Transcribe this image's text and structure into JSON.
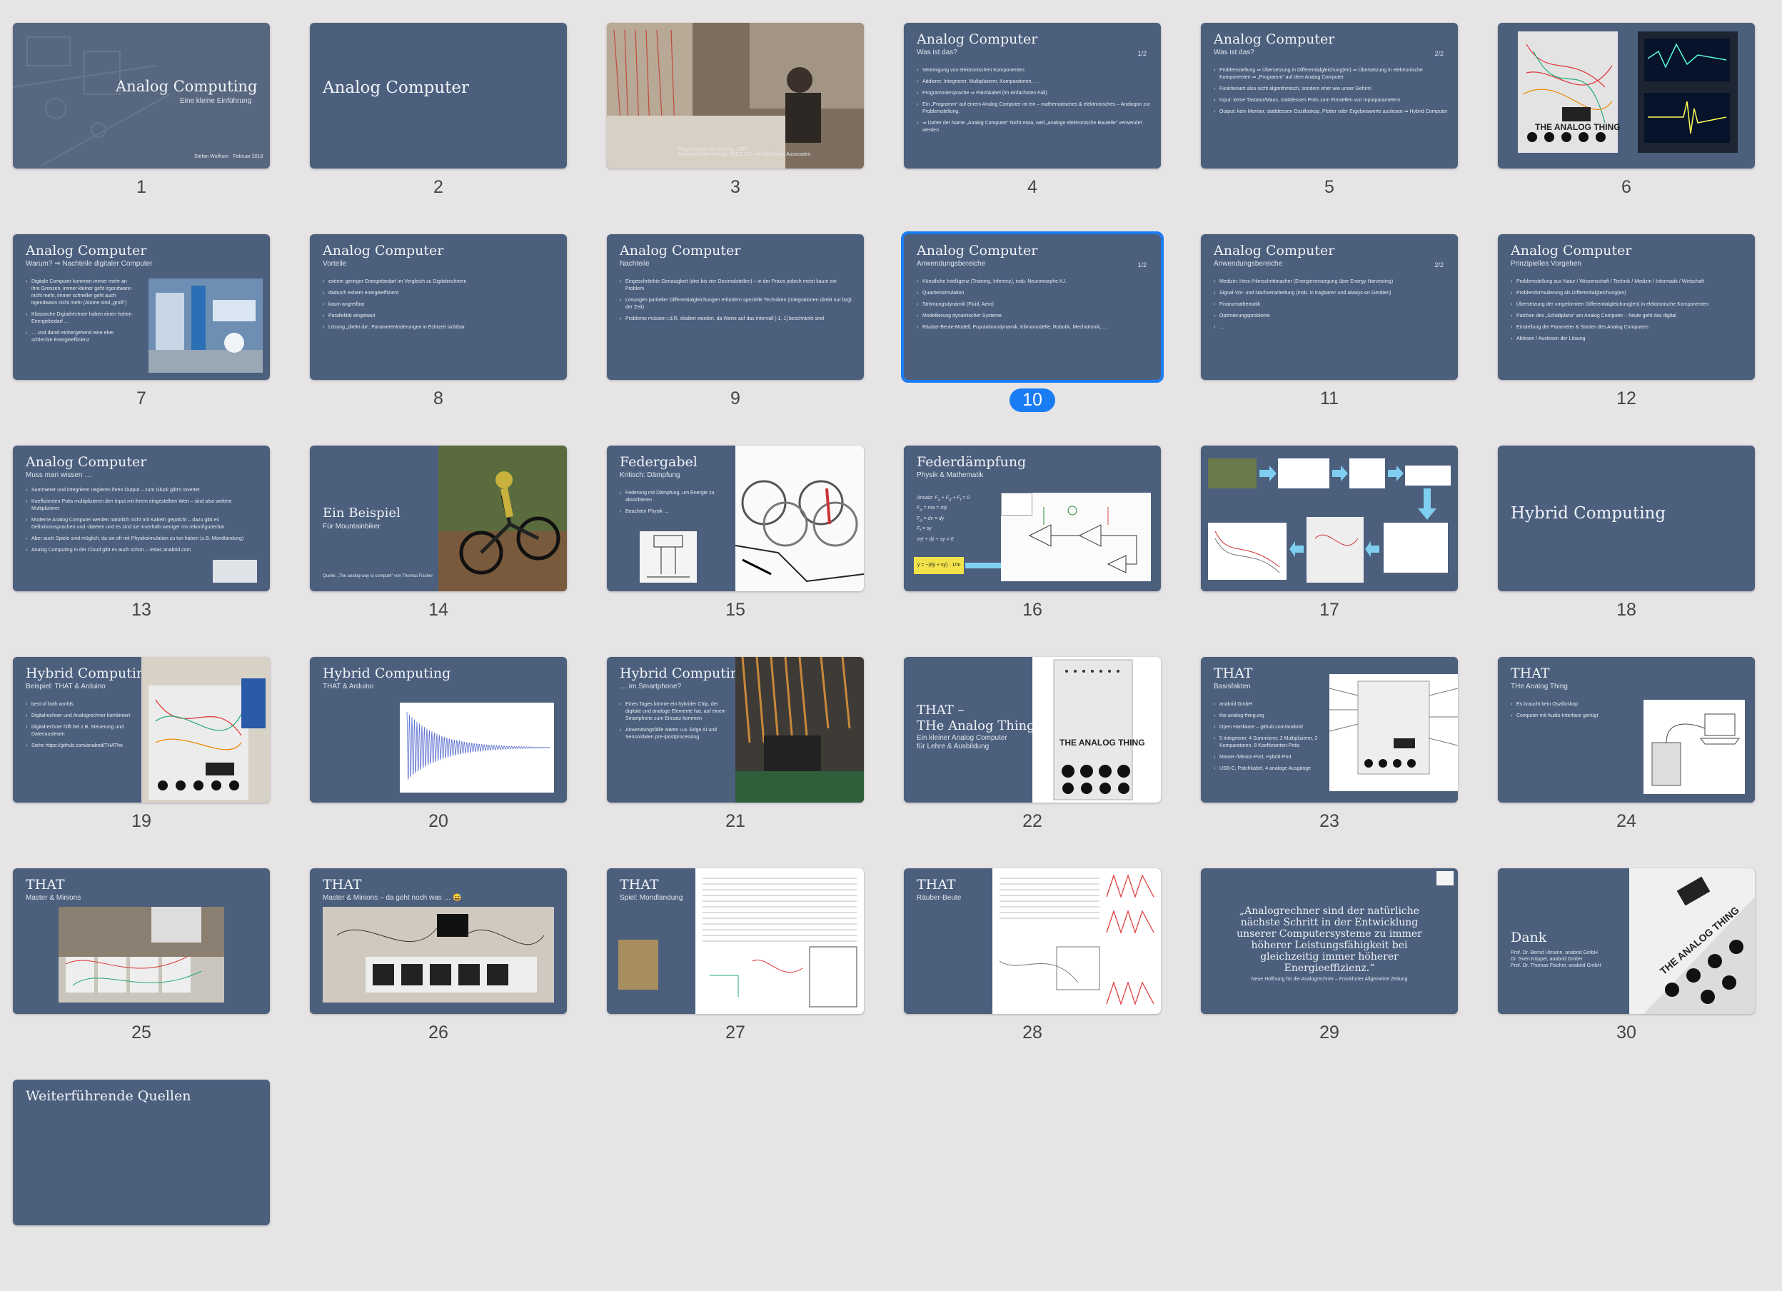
{
  "slides": [
    {
      "n": "1",
      "title": "Analog Computing",
      "subtitle": "Eine kleine Einführung",
      "footer": "Stefan Wolfrum · Februar 2018"
    },
    {
      "n": "2",
      "title": "Analog Computer"
    },
    {
      "n": "3",
      "caption": "Flugsimulator bei Boeing, 1960\nAnalogrechner-Anlage PACE 231 von Electronic Associates"
    },
    {
      "n": "4",
      "title": "Analog Computer",
      "subtitle": "Was ist das?",
      "page": "1/2",
      "bullets": [
        "Vereinigung von elektronischen Komponenten",
        "Addierer, Integrierer, Multiplizierer, Komparatoren, …",
        "Programmiersprache ⇒ Patchkabel (im einfachsten Fall)",
        "Ein „Programm“ auf einem Analog Computer ist ein – mathematisches & elektronisches – Analogon zur Problemstellung.",
        "⇒ Daher der Name „Analog Computer“ Nicht etwa, weil „analoge elektronische Bauteile“ verwendet werden"
      ]
    },
    {
      "n": "5",
      "title": "Analog Computer",
      "subtitle": "Was ist das?",
      "page": "2/2",
      "bullets": [
        "Problemstellung ⇒ Übersetzung in Differentialgleichung(en) ⇒ Übersetzung in elektronische Komponenten ⇒ „Programm“ auf dem Analog Computer",
        "Funktioniert also nicht algorithmisch, sondern eher wie unser Gehirn!",
        "Input: keine Tastatur/Maus, stattdessen Potis zum Einstellen von Inputparametern",
        "Output: kein Monitor, stattdessen Oszilloskop, Plotter oder Ergebniswerte auslesen ⇒ Hybrid Computer"
      ]
    },
    {
      "n": "6",
      "caption": "THE ANALOG THING"
    },
    {
      "n": "7",
      "title": "Analog Computer",
      "subtitle": "Warum? ⇒ Nachteile digitaler Computer",
      "bullets": [
        "Digitale Computer kommen immer mehr an ihre Grenzen, immer kleiner geht irgendwann nicht mehr, immer schneller geht auch irgendwann nicht mehr (Atome sind „groß“)",
        "Klassische Digitalrechner haben einen hohen Energiebedarf …",
        "… und damit einhergehend eine eher schlechte Energieeffizienz"
      ]
    },
    {
      "n": "8",
      "title": "Analog Computer",
      "subtitle": "Vorteile",
      "bullets": [
        "extrem geringer Energiebedarf im Vergleich zu Digitalrechnern",
        "dadurch extrem energieeffizient",
        "kaum angreifbar",
        "Parallelität eingebaut",
        "Lösung „direkt da“, Parameteränderungen in Echtzeit sichtbar"
      ]
    },
    {
      "n": "9",
      "title": "Analog Computer",
      "subtitle": "Nachteile",
      "bullets": [
        "Eingeschränkte Genauigkeit (drei bis vier Dezimalstellen) – in der Praxis jedoch meist kaum ein Problem",
        "Lösungen partieller Differentialgleichungen erfordern spezielle Techniken (Integrationen direkt nur bzgl. der Zeit)",
        "Probleme müssen i.d.R. skaliert werden, da Werte auf das Intervall [-1, 1] beschränkt sind"
      ]
    },
    {
      "n": "10",
      "title": "Analog Computer",
      "subtitle": "Anwendungsbereiche",
      "page": "1/2",
      "bullets": [
        "Künstliche Intelligenz (Training, Inferenz), insb. Neuromorphe K.I.",
        "Quantensimulation",
        "Strömungsdynamik (Fluid, Aero)",
        "Modellierung dynamischer Systeme",
        "Räuber-Beute-Modell, Populationsdynamik, Klimamodelle, Robotik, Mechatronik, …"
      ]
    },
    {
      "n": "11",
      "title": "Analog Computer",
      "subtitle": "Anwendungsbereiche",
      "page": "2/2",
      "bullets": [
        "Medizin: Herz-/Hirnschrittmacher (Energieversorgung über Energy Harvesting)",
        "Signal-Vor- und Nachverarbeitung (insb. in tragbaren und always-on Geräten)",
        "Finanzmathematik",
        "Optimierungsprobleme",
        "…"
      ]
    },
    {
      "n": "12",
      "title": "Analog Computer",
      "subtitle": "Prinzipielles Vorgehen",
      "bullets": [
        "Problemstellung aus Natur / Wissenschaft / Technik / Medizin / Informatik / Wirtschaft",
        "Problemformulierung als Differentialgleichung(en)",
        "Übersetzung der umgeformten Differentialgleichung(en) in elektronische Komponenten",
        "Patchen des „Schaltplans“ am Analog Computer – heute geht das digital",
        "Einstellung der Parameter & Starten des Analog Computers",
        "Ablesen / Auslesen der Lösung"
      ]
    },
    {
      "n": "13",
      "title": "Analog Computer",
      "subtitle": "Muss man wissen …",
      "bullets": [
        "Summierer und Integrierer negieren ihren Output – zum Glück gibt's Inverter",
        "Koeffizienten-Potis multiplizieren den Input mit ihrem eingestellten Wert – sind also weitere Multiplizierer",
        "Moderne Analog Computer werden natürlich nicht mit Kabeln gepatcht – dazu gibt es Definitionssprachen und -dateien und es sind sie innerhalb weniger ms rekonfigurierbar",
        "Aber auch Spiele sind möglich, da sie oft mit Physiksimulation zu tun haben (z.B. Mondlandung)",
        "Analog Computing in der Cloud gibt es auch schon – redac.anabrid.com"
      ]
    },
    {
      "n": "14",
      "title": "Ein Beispiel",
      "subtitle": "Für Mountainbiker",
      "footer": "Quelle: „The analog way to compute“ von Thomas Fischer"
    },
    {
      "n": "15",
      "title": "Federgabel",
      "subtitle": "Kritisch: Dämpfung",
      "bullets": [
        "Federung mit Dämpfung, um Energie zu absorbieren",
        "Beachten Physik …"
      ]
    },
    {
      "n": "16",
      "title": "Federdämpfung",
      "subtitle": "Physik & Mathematik",
      "formula": "ÿ = −(dẏ + sy) · 1/m"
    },
    {
      "n": "17"
    },
    {
      "n": "18",
      "title": "Hybrid Computing"
    },
    {
      "n": "19",
      "title": "Hybrid Computing",
      "subtitle": "Beispiel: THAT & Arduino",
      "bullets": [
        "best of both worlds",
        "Digitalrechner und Analogrechner kombiniert",
        "Digitalrechner hilft bei z.B. Steuerung und Datenauslesen",
        "Siehe https://github.com/anabrid/THATho"
      ]
    },
    {
      "n": "20",
      "title": "Hybrid Computing",
      "subtitle": "THAT & Arduino"
    },
    {
      "n": "21",
      "title": "Hybrid Computing",
      "subtitle": "… im Smartphone?",
      "bullets": [
        "Eines Tages könnte ein hybrider Chip, der digitale und analoge Elemente hat, auf einem Smartphone zum Einsatz kommen",
        "Anwendungsfälle wären u.a. Edge AI und Sensordaten pre-/postprocessing"
      ]
    },
    {
      "n": "22",
      "title": "THAT –\nTHe Analog Thing",
      "subtitle": "Ein kleiner Analog Computer\nfür Lehre & Ausbildung"
    },
    {
      "n": "23",
      "title": "THAT",
      "subtitle": "Basisfakten",
      "bullets": [
        "anabrid GmbH",
        "the-analog-thing.org",
        "Open Hardware – github.com/anabrid",
        "5 Integrierer, 4 Summierer, 2 Multiplizierer, 2 Komparatoren, 8 Koeffizienten-Potis",
        "Master-/Minion-Port, Hybrid-Port",
        "USB-C, Patchkabel, 4 analoge Ausgänge"
      ]
    },
    {
      "n": "24",
      "title": "THAT",
      "subtitle": "THe Analog Thing",
      "bullets": [
        "Es braucht kein Oszilloskop",
        "Computer mit Audio-Interface genügt"
      ]
    },
    {
      "n": "25",
      "title": "THAT",
      "subtitle": "Master & Minions"
    },
    {
      "n": "26",
      "title": "THAT",
      "subtitle": "Master & Minions – da geht noch was … 😅"
    },
    {
      "n": "27",
      "title": "THAT",
      "subtitle": "Spiel: Mondlandung"
    },
    {
      "n": "28",
      "title": "THAT",
      "subtitle": "Räuber-Beute"
    },
    {
      "n": "29",
      "quote": "„Analogrechner sind der natürliche nächste Schritt in der Entwicklung unserer Computersysteme zu immer höherer Leistungsfähigkeit bei gleichzeitig immer höherer Energieeffizienz.“",
      "source": "Neue Hoffnung für die Analogrechner – Frankfurter Allgemeine Zeitung"
    },
    {
      "n": "30",
      "title": "Dank",
      "subtitle": "Prof. Dr. Bernd Ulmann, anabrid GmbH\nDr. Sven Köppel, anabrid GmbH\nProf. Dr. Thomas Fischer, anabrid GmbH"
    },
    {
      "n": "31",
      "title": "Weiterführende Quellen"
    }
  ],
  "selected": "10",
  "colors": {
    "slide_bg": "#4c5f7d",
    "canvas": "#e6e4e5",
    "selection": "#1a7cf2"
  }
}
